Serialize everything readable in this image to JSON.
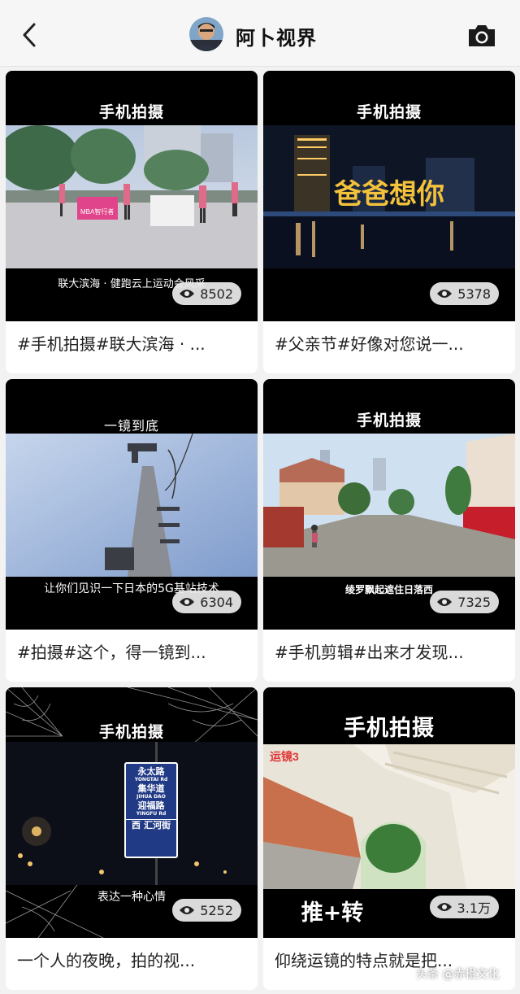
{
  "header": {
    "title": "阿卜视界",
    "back_icon": "chevron-left-icon",
    "camera_icon": "camera-icon"
  },
  "cards": [
    {
      "caption_top": "手机拍摄",
      "caption_bottom": "联大滨海 · 健跑云上运动会风采",
      "views": "8502",
      "title": "#手机拍摄#联大滨海 · ...",
      "overlay_text": "MBA智行者"
    },
    {
      "caption_top": "手机拍摄",
      "caption_bottom": "",
      "views": "5378",
      "title": "#父亲节#好像对您说一...",
      "overlay_text": "爸爸想你"
    },
    {
      "caption_top": "一镜到底",
      "caption_bottom": "让你们见识一下日本的5G基站技术",
      "views": "6304",
      "title": "#拍摄#这个，得一镜到..."
    },
    {
      "caption_top": "手机拍摄",
      "caption_bottom": "绫罗飘起遮住日落西",
      "views": "7325",
      "title": "#手机剪辑#出来才发现..."
    },
    {
      "caption_top": "手机拍摄",
      "caption_bottom": "表达一种心情",
      "views": "5252",
      "title": "一个人的夜晚，拍的视...",
      "sign_lines": [
        "永太路",
        "YONGTAI Rd",
        "集华道",
        "JIHUA DAO",
        "迎福路",
        "YINGFU Rd",
        "西",
        "汇河街"
      ]
    },
    {
      "caption_top": "手机拍摄",
      "caption_bottom": "推+转",
      "views": "3.1万",
      "title": "仰绕运镜的特点就是把...",
      "overlay_text": "运镜3"
    }
  ],
  "watermark": "头条 @赤橙文化",
  "colors": {
    "header_bg": "#f6f6f6",
    "page_bg": "#f2f2f2",
    "thumb_bg": "#000000",
    "badge_bg": "#ebebeb"
  }
}
